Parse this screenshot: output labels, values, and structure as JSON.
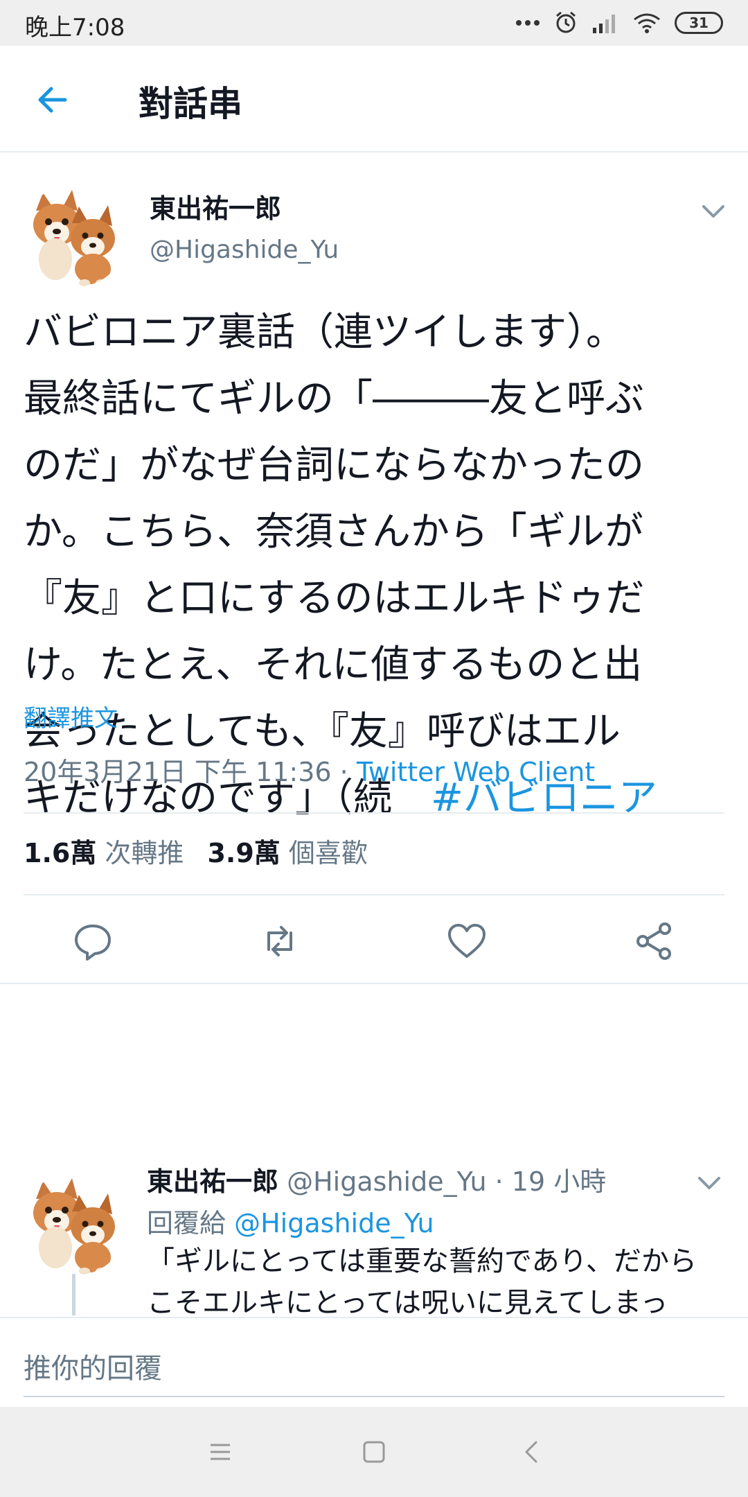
{
  "status_bar": {
    "time": "晚上7:08",
    "battery": "31"
  },
  "header": {
    "title": "對話串"
  },
  "tweet": {
    "author_name": "東出祐一郎",
    "author_handle": "@Higashide_Yu",
    "body_lines": [
      "バビロニア裏話（連ツイします）。",
      "最終話にてギルの「―――友と呼ぶ",
      "のだ」がなぜ台詞にならなかったの",
      "か。こちら、奈須さんから「ギルが",
      "『友』と口にするのはエルキドゥだ",
      "け。たとえ、それに値するものと出",
      "会ったとしても、『友』呼びはエル",
      "キだけなのです」（続　"
    ],
    "hashtag": "#バビロニア",
    "translate_label": "翻譯推文",
    "timestamp": "20年3月21日 下午 11:36",
    "separator": " · ",
    "source": "Twitter Web Client",
    "retweet_count": "1.6萬",
    "retweet_label": "次轉推",
    "like_count": "3.9萬",
    "like_label": "個喜歡"
  },
  "reply": {
    "author_name": "東出祐一郎",
    "author_handle": "@Higashide_Yu",
    "time": "· 19 小時",
    "reply_to_label": "回覆給",
    "reply_to_handle": "@Higashide_Yu",
    "text_lines": [
      "「ギルにとっては重要な誓約であり、だから",
      "こそエルキにとっては呪いに見えてしまっ"
    ]
  },
  "compose": {
    "placeholder": "推你的回覆"
  },
  "colors": {
    "accent": "#1b95e0",
    "secondary_text": "#657786",
    "divider": "#e6ecf0"
  },
  "icons": {
    "back": "arrow-left-icon",
    "reply": "comment-icon",
    "retweet": "retweet-icon",
    "like": "heart-icon",
    "share": "share-icon"
  }
}
